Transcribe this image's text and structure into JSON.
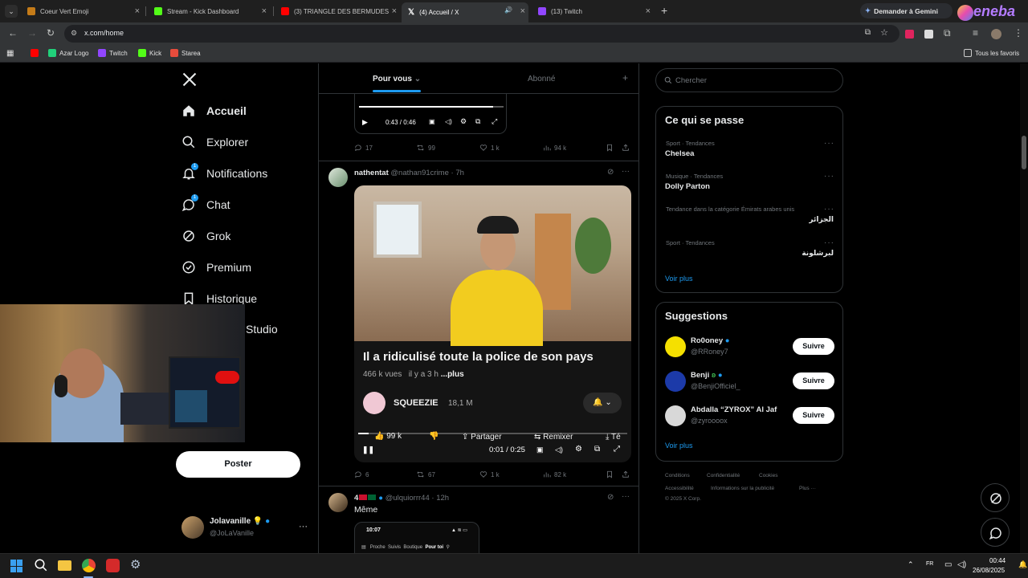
{
  "browser": {
    "tabs": [
      {
        "title": "Coeur Vert Emoji",
        "color": "#2ecc71"
      },
      {
        "title": "Stream - Kick Dashboard",
        "color": "#53fc18"
      },
      {
        "title": "(3) TRIANGLE DES BERMUDES",
        "color": "#ff0000"
      },
      {
        "title": "(4) Accueil / X",
        "color": "#ffffff"
      },
      {
        "title": "(13) Twitch",
        "color": "#9146ff"
      }
    ],
    "gemini_label": "Demander à Gemini",
    "url": "x.com/home",
    "bookmarks": [
      {
        "label": "Azar Logo",
        "color": "#21d07a"
      },
      {
        "label": "Twitch",
        "color": "#9146ff"
      },
      {
        "label": "Kick",
        "color": "#53fc18"
      },
      {
        "label": "Starea",
        "color": "#e74c3c"
      }
    ],
    "all_bookmarks": "Tous les favoris",
    "brand_badge": "eneba"
  },
  "nav": {
    "items": [
      {
        "label": "Accueil",
        "icon": "home-icon"
      },
      {
        "label": "Explorer",
        "icon": "search-icon"
      },
      {
        "label": "Notifications",
        "icon": "bell-icon",
        "badge": "1"
      },
      {
        "label": "Chat",
        "icon": "chat-icon",
        "badge": "1"
      },
      {
        "label": "Grok",
        "icon": "grok-icon"
      },
      {
        "label": "Premium",
        "icon": "premium-icon"
      },
      {
        "label": "Historique",
        "icon": "bookmark-icon"
      },
      {
        "label": "Studio",
        "icon": "studio-icon"
      }
    ],
    "post_label": "Poster",
    "account": {
      "name": "Jolavanille",
      "emoji": "💡",
      "handle": "@JoLaVanille"
    }
  },
  "feed": {
    "tabs": [
      "Pour vous",
      "Abonné"
    ],
    "tweet1": {
      "video_time": "0:43 / 0:46",
      "stats": {
        "replies": "17",
        "reposts": "99",
        "likes": "1 k",
        "views": "94 k"
      }
    },
    "tweet2": {
      "name": "nathentat",
      "handle": "@nathan91crime",
      "time": "· 7h",
      "embed_title": "Il a ridiculisé toute la police de son pays",
      "embed_meta": "466 k vues   il y a 3 h",
      "more": "...plus",
      "channel": "SQUEEZIE",
      "subs": "18,1 M",
      "yt_likes": "99 k",
      "share": "Partager",
      "remix": "Remixer",
      "download": "Té",
      "video_time": "0:01 / 0:25",
      "stats": {
        "replies": "6",
        "reposts": "67",
        "likes": "1 k",
        "views": "82 k"
      }
    },
    "tweet3": {
      "name": "4",
      "handle": "@ulquiorrr44",
      "time": "· 12h",
      "text": "Même",
      "phone_time": "10:07",
      "phone_tabs": [
        "Proche",
        "Suivis",
        "Boutique",
        "Pour toi"
      ]
    }
  },
  "sidebar": {
    "search_placeholder": "Chercher",
    "trends_title": "Ce qui se passe",
    "trends": [
      {
        "category": "Sport · Tendances",
        "name": "Chelsea"
      },
      {
        "category": "Musique · Tendances",
        "name": "Dolly Parton"
      },
      {
        "category": "Tendance dans la catégorie Émirats arabes unis",
        "name": "الجزائر"
      },
      {
        "category": "Sport · Tendances",
        "name": "لبرشلونة"
      }
    ],
    "more": "Voir plus",
    "suggestions_title": "Suggestions",
    "suggestions": [
      {
        "name": "Ro0oney",
        "handle": "@RRoney7",
        "color": "#f5e000"
      },
      {
        "name": "Benji",
        "handle": "@BenjiOfficiel_",
        "color": "#1c3aa9"
      },
      {
        "name": "Abdalla “ZYROX” Al Jaf",
        "handle": "@zyroooox",
        "color": "#d8d8d8"
      }
    ],
    "follow_label": "Suivre",
    "footer": [
      "Conditions",
      "Confidentialité",
      "Cookies",
      "Accessibilité",
      "Informations sur la publicité",
      "Plus ···",
      "© 2025 X Corp."
    ]
  },
  "taskbar": {
    "time": "00:44",
    "date": "26/08/2025"
  },
  "colors": {
    "accent": "#1d9bf0",
    "background": "#000000",
    "border": "#2f3336"
  }
}
